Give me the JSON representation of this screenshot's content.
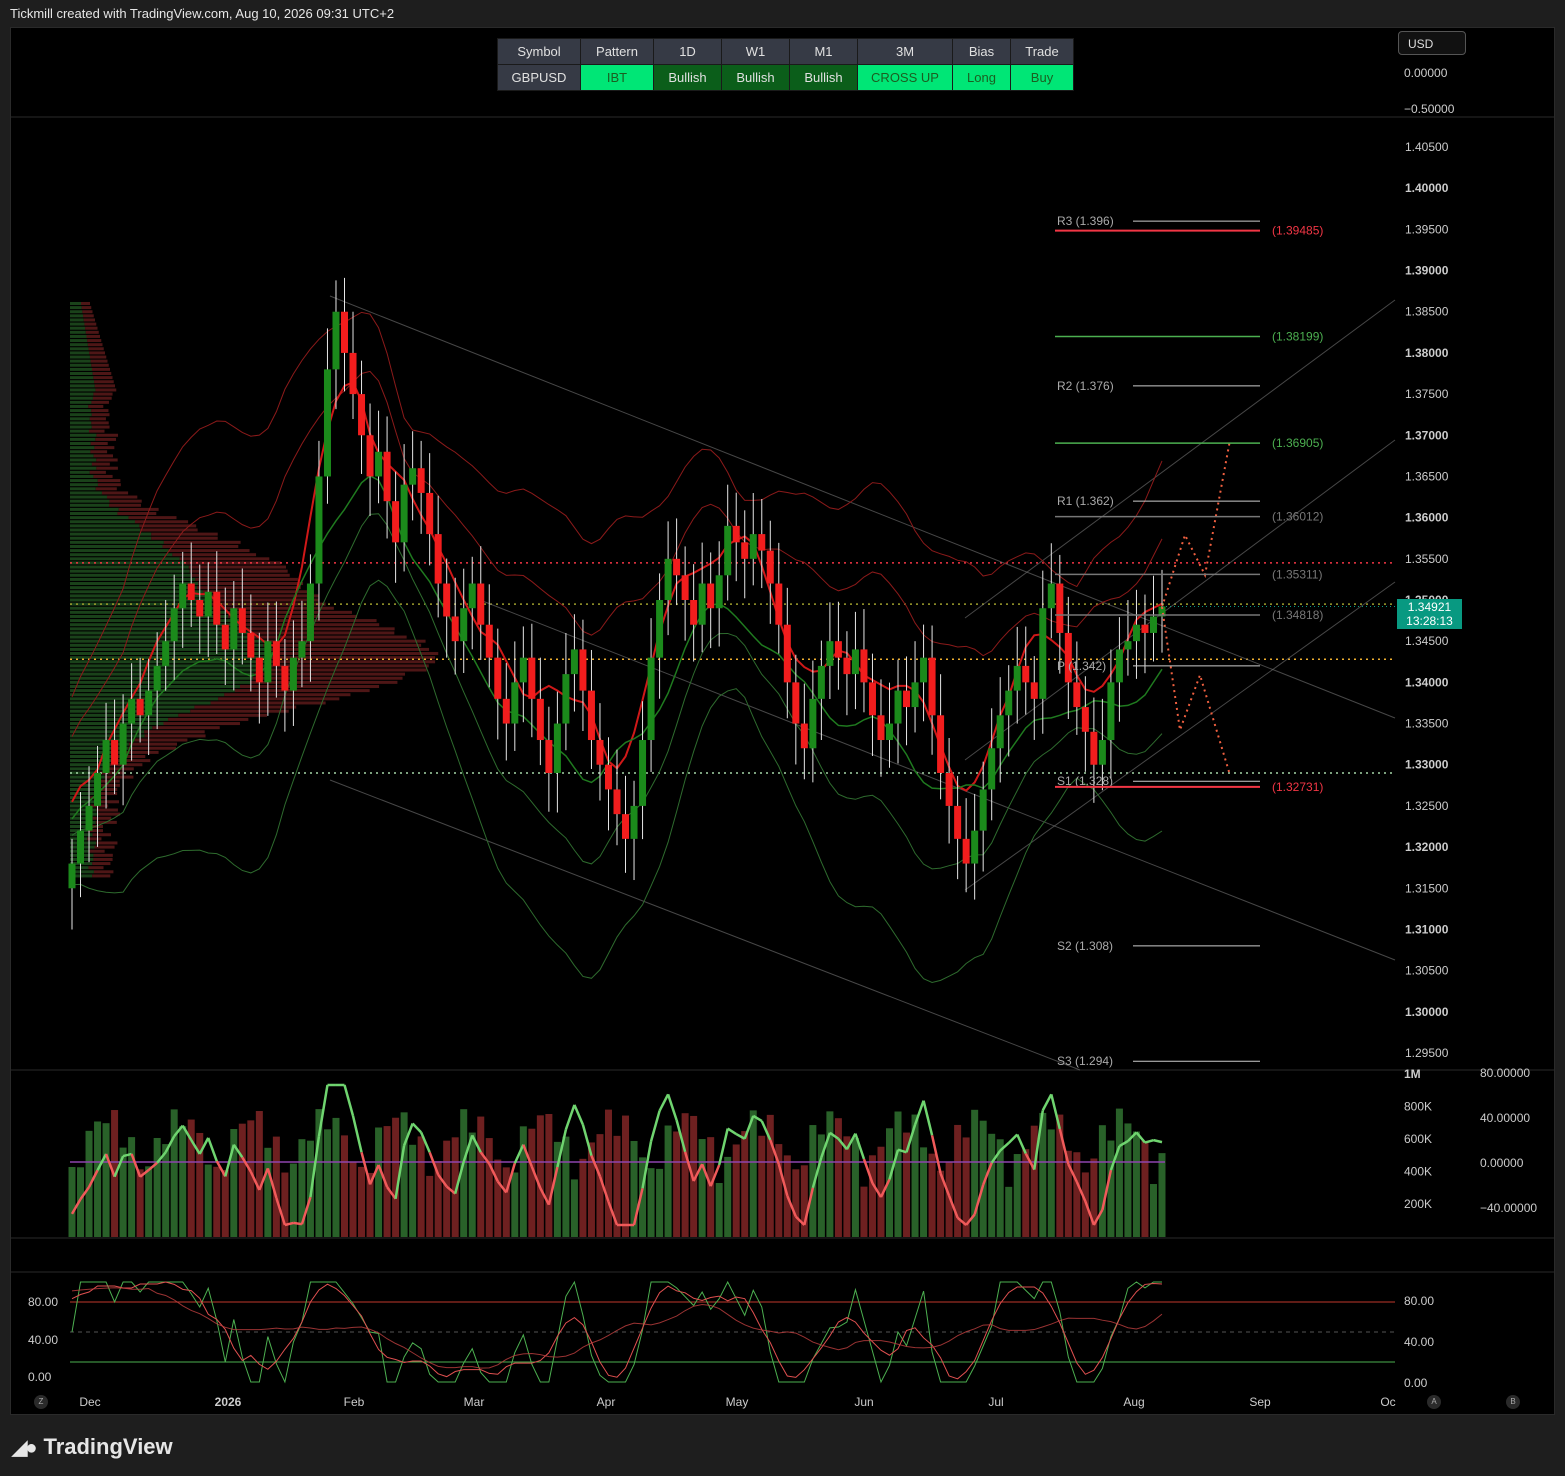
{
  "header": {
    "text": "Tickmill created with TradingView.com, Aug 10, 2026 09:31 UTC+2"
  },
  "signal_table": {
    "headers": [
      "Symbol",
      "Pattern",
      "1D",
      "W1",
      "M1",
      "3M",
      "Bias",
      "Trade"
    ],
    "values": [
      "GBPUSD",
      "IBT",
      "Bullish",
      "Bullish",
      "Bullish",
      "CROSS UP",
      "Long",
      "Buy"
    ],
    "colors": [
      "#363a45",
      "#00e676",
      "#0b5e1a",
      "#0b5e1a",
      "#0b5e1a",
      "#00e676",
      "#00e676",
      "#00e676"
    ]
  },
  "toolbar": {
    "currency_label": "USD",
    "left_button": "Z",
    "a_button": "A",
    "b_button": "B"
  },
  "last_price": {
    "value": "1.34921",
    "countdown": "13:28:13"
  },
  "footer": {
    "brand": "TradingView"
  },
  "colors": {
    "up": "#1b8a1b",
    "down": "#f21d1d",
    "bg": "#000000",
    "price_tag": "#089981"
  },
  "chart_data": {
    "type": "candlestick",
    "symbol": "GBPUSD",
    "x_ticks": [
      "Dec",
      "2026",
      "Feb",
      "Mar",
      "Apr",
      "May",
      "Jun",
      "Jul",
      "Aug",
      "Sep",
      "Oc"
    ],
    "y_ticks": [
      "1.40500",
      "1.40000",
      "1.39500",
      "1.39000",
      "1.38500",
      "1.38000",
      "1.37500",
      "1.37000",
      "1.36500",
      "1.36000",
      "1.35500",
      "1.35000",
      "1.34500",
      "1.34000",
      "1.33500",
      "1.33000",
      "1.32500",
      "1.32000",
      "1.31500",
      "1.31000",
      "1.30500",
      "1.30000",
      "1.29500"
    ],
    "ylim": [
      1.2925,
      1.4075
    ],
    "top_scale_ticks": [
      "0.00000",
      "−0.50000"
    ],
    "pivots": [
      {
        "label": "R3 (1.396)",
        "value": 1.396
      },
      {
        "label": "R2 (1.376)",
        "value": 1.376
      },
      {
        "label": "R1 (1.362)",
        "value": 1.362
      },
      {
        "label": "P (1.342)",
        "value": 1.342
      },
      {
        "label": "S1 (1.328)",
        "value": 1.328
      },
      {
        "label": "S2 (1.308)",
        "value": 1.308
      },
      {
        "label": "S3 (1.294)",
        "value": 1.294
      }
    ],
    "levels": [
      {
        "label": "(1.39485)",
        "value": 1.39485,
        "color": "#f23645"
      },
      {
        "label": "(1.38199)",
        "value": 1.38199,
        "color": "#4caf50"
      },
      {
        "label": "(1.36905)",
        "value": 1.36905,
        "color": "#4caf50"
      },
      {
        "label": "(1.36012)",
        "value": 1.36012,
        "color": "#777777"
      },
      {
        "label": "(1.35311)",
        "value": 1.35311,
        "color": "#777777"
      },
      {
        "label": "(1.34818)",
        "value": 1.34818,
        "color": "#777777"
      },
      {
        "label": "(1.32731)",
        "value": 1.32731,
        "color": "#f23645"
      }
    ],
    "dotted_levels": [
      {
        "value": 1.3545,
        "color": "#f23645"
      },
      {
        "value": 1.3495,
        "color": "#9e9e2e"
      },
      {
        "value": 1.3428,
        "color": "#f0b030"
      },
      {
        "value": 1.329,
        "color": "#a5d6a7"
      }
    ],
    "close_series": [
      1.318,
      1.322,
      1.325,
      1.329,
      1.333,
      1.33,
      1.335,
      1.338,
      1.336,
      1.339,
      1.342,
      1.345,
      1.349,
      1.352,
      1.35,
      1.348,
      1.351,
      1.347,
      1.344,
      1.349,
      1.346,
      1.343,
      1.34,
      1.345,
      1.342,
      1.339,
      1.343,
      1.345,
      1.352,
      1.365,
      1.378,
      1.385,
      1.38,
      1.375,
      1.37,
      1.365,
      1.368,
      1.362,
      1.357,
      1.364,
      1.366,
      1.363,
      1.358,
      1.352,
      1.348,
      1.345,
      1.349,
      1.352,
      1.347,
      1.343,
      1.338,
      1.335,
      1.34,
      1.343,
      1.338,
      1.333,
      1.329,
      1.335,
      1.341,
      1.344,
      1.339,
      1.333,
      1.33,
      1.327,
      1.324,
      1.321,
      1.325,
      1.333,
      1.343,
      1.35,
      1.355,
      1.353,
      1.35,
      1.347,
      1.352,
      1.349,
      1.353,
      1.359,
      1.357,
      1.355,
      1.358,
      1.356,
      1.352,
      1.347,
      1.34,
      1.335,
      1.332,
      1.338,
      1.342,
      1.345,
      1.343,
      1.341,
      1.344,
      1.34,
      1.336,
      1.333,
      1.335,
      1.339,
      1.337,
      1.34,
      1.343,
      1.336,
      1.329,
      1.325,
      1.321,
      1.318,
      1.322,
      1.327,
      1.332,
      1.336,
      1.339,
      1.342,
      1.34,
      1.338,
      1.349,
      1.352,
      1.346,
      1.34,
      1.337,
      1.334,
      1.33,
      1.333,
      1.34,
      1.344,
      1.345,
      1.347,
      1.346,
      1.348,
      1.34921
    ],
    "volume_ticks": [
      "1M",
      "800K",
      "600K",
      "400K",
      "200K"
    ],
    "osc_ticks": [
      "80.00000",
      "40.00000",
      "0.00000",
      "−40.00000"
    ],
    "stoch_ticks_left": [
      "80.00",
      "40.00",
      "0.00"
    ],
    "stoch_ticks_right": [
      "80.00",
      "40.00",
      "0.00"
    ],
    "stoch_bands": [
      80,
      20
    ]
  }
}
